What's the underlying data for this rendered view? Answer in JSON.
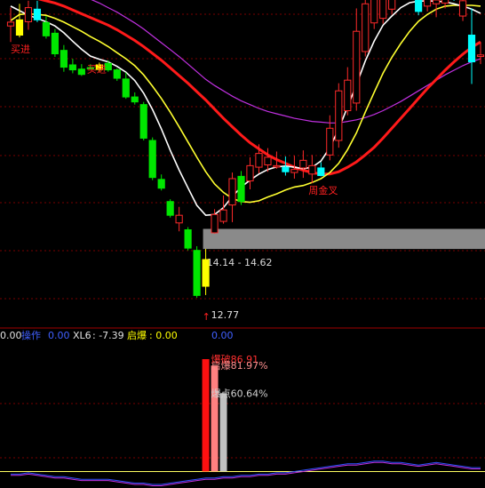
{
  "chart_data": {
    "type": "candlestick",
    "main_panel": {
      "ylim": [
        12.0,
        20.5
      ],
      "candles": [
        {
          "o": 19.82,
          "h": 20.3,
          "l": 19.4,
          "c": 19.92,
          "color": "red"
        },
        {
          "o": 19.98,
          "h": 20.4,
          "l": 19.52,
          "c": 19.58,
          "color": "yellow"
        },
        {
          "o": 19.93,
          "h": 20.48,
          "l": 19.72,
          "c": 20.3,
          "color": "red"
        },
        {
          "o": 20.26,
          "h": 20.48,
          "l": 19.92,
          "c": 19.98,
          "color": "cyan"
        },
        {
          "o": 19.91,
          "h": 20.08,
          "l": 19.49,
          "c": 19.56,
          "color": "green"
        },
        {
          "o": 19.63,
          "h": 19.74,
          "l": 19.01,
          "c": 19.09,
          "color": "green"
        },
        {
          "o": 19.18,
          "h": 19.32,
          "l": 18.62,
          "c": 18.74,
          "color": "green"
        },
        {
          "o": 18.8,
          "h": 18.96,
          "l": 18.58,
          "c": 18.67,
          "color": "green"
        },
        {
          "o": 18.69,
          "h": 18.82,
          "l": 18.51,
          "c": 18.55,
          "color": "green"
        },
        {
          "o": 18.72,
          "h": 18.82,
          "l": 18.69,
          "c": 18.73,
          "color": "green"
        },
        {
          "o": 18.68,
          "h": 18.86,
          "l": 18.62,
          "c": 18.8,
          "color": "yellow"
        },
        {
          "o": 18.84,
          "h": 18.92,
          "l": 18.62,
          "c": 18.67,
          "color": "green"
        },
        {
          "o": 18.67,
          "h": 18.71,
          "l": 18.38,
          "c": 18.45,
          "color": "green"
        },
        {
          "o": 18.43,
          "h": 18.6,
          "l": 17.91,
          "c": 17.96,
          "color": "green"
        },
        {
          "o": 17.96,
          "h": 18.08,
          "l": 17.76,
          "c": 17.83,
          "color": "green"
        },
        {
          "o": 17.76,
          "h": 17.83,
          "l": 16.82,
          "c": 16.88,
          "color": "green"
        },
        {
          "o": 16.82,
          "h": 16.9,
          "l": 15.78,
          "c": 15.85,
          "color": "green"
        },
        {
          "o": 15.8,
          "h": 15.93,
          "l": 15.51,
          "c": 15.57,
          "color": "green"
        },
        {
          "o": 15.22,
          "h": 15.28,
          "l": 14.8,
          "c": 14.86,
          "color": "green"
        },
        {
          "o": 14.66,
          "h": 15.08,
          "l": 14.44,
          "c": 14.86,
          "color": "red"
        },
        {
          "o": 14.48,
          "h": 14.55,
          "l": 13.94,
          "c": 14.0,
          "color": "green"
        },
        {
          "o": 13.94,
          "h": 14.05,
          "l": 12.7,
          "c": 12.76,
          "color": "green"
        },
        {
          "o": 13.0,
          "h": 13.98,
          "l": 12.77,
          "c": 13.7,
          "color": "yellow"
        },
        {
          "o": 14.4,
          "h": 15.02,
          "l": 14.38,
          "c": 14.88,
          "color": "red"
        },
        {
          "o": 14.7,
          "h": 15.38,
          "l": 14.64,
          "c": 15.0,
          "color": "red"
        },
        {
          "o": 15.13,
          "h": 15.98,
          "l": 14.68,
          "c": 15.82,
          "color": "red"
        },
        {
          "o": 15.22,
          "h": 16.02,
          "l": 15.13,
          "c": 15.88,
          "color": "green"
        },
        {
          "o": 15.76,
          "h": 16.38,
          "l": 15.54,
          "c": 16.16,
          "color": "red"
        },
        {
          "o": 16.12,
          "h": 16.72,
          "l": 15.96,
          "c": 16.48,
          "color": "red"
        },
        {
          "o": 16.38,
          "h": 16.62,
          "l": 16.0,
          "c": 16.18,
          "color": "red"
        },
        {
          "o": 16.14,
          "h": 16.53,
          "l": 16.08,
          "c": 16.16,
          "color": "red"
        },
        {
          "o": 16.12,
          "h": 16.4,
          "l": 15.9,
          "c": 16.0,
          "color": "cyan"
        },
        {
          "o": 15.98,
          "h": 16.42,
          "l": 15.82,
          "c": 16.06,
          "color": "red"
        },
        {
          "o": 16.1,
          "h": 16.56,
          "l": 15.84,
          "c": 16.3,
          "color": "red"
        },
        {
          "o": 15.94,
          "h": 16.44,
          "l": 15.7,
          "c": 16.16,
          "color": "red"
        },
        {
          "o": 15.9,
          "h": 16.25,
          "l": 15.88,
          "c": 16.1,
          "color": "cyan"
        },
        {
          "o": 16.44,
          "h": 17.48,
          "l": 16.3,
          "c": 17.14,
          "color": "red"
        },
        {
          "o": 16.82,
          "h": 18.32,
          "l": 16.63,
          "c": 18.12,
          "color": "red"
        },
        {
          "o": 17.6,
          "h": 18.74,
          "l": 17.48,
          "c": 18.4,
          "color": "red"
        },
        {
          "o": 17.8,
          "h": 20.28,
          "l": 17.6,
          "c": 19.68,
          "color": "red"
        },
        {
          "o": 19.15,
          "h": 20.6,
          "l": 19.02,
          "c": 20.4,
          "color": "red"
        },
        {
          "o": 19.9,
          "h": 20.96,
          "l": 19.74,
          "c": 20.64,
          "color": "red"
        },
        {
          "o": 20.02,
          "h": 20.84,
          "l": 19.88,
          "c": 20.56,
          "color": "red"
        },
        {
          "o": 20.26,
          "h": 21.06,
          "l": 20.14,
          "c": 20.86,
          "color": "red"
        },
        {
          "o": 20.62,
          "h": 21.13,
          "l": 20.52,
          "c": 20.76,
          "color": "red"
        },
        {
          "o": 20.88,
          "h": 21.1,
          "l": 20.54,
          "c": 20.72,
          "color": "red"
        },
        {
          "o": 20.96,
          "h": 21.04,
          "l": 20.1,
          "c": 20.2,
          "color": "cyan"
        },
        {
          "o": 20.34,
          "h": 20.94,
          "l": 20.2,
          "c": 20.8,
          "color": "red"
        },
        {
          "o": 20.5,
          "h": 20.78,
          "l": 20.05,
          "c": 20.4,
          "color": "red"
        },
        {
          "o": 20.42,
          "h": 20.82,
          "l": 20.28,
          "c": 20.66,
          "color": "red"
        },
        {
          "o": 20.8,
          "h": 21.12,
          "l": 20.48,
          "c": 20.56,
          "color": "cyan"
        },
        {
          "o": 20.48,
          "h": 20.78,
          "l": 19.95,
          "c": 20.08,
          "color": "red"
        },
        {
          "o": 19.58,
          "h": 20.28,
          "l": 18.3,
          "c": 18.88,
          "color": "cyan"
        },
        {
          "o": 19.06,
          "h": 19.4,
          "l": 18.82,
          "c": 19.02,
          "color": "red"
        }
      ],
      "white_line": [
        20.34,
        20.22,
        20.1,
        20.02,
        19.93,
        19.82,
        19.64,
        19.42,
        19.21,
        19.03,
        18.95,
        18.88,
        18.76,
        18.61,
        18.39,
        18.06,
        17.63,
        17.12,
        16.56,
        16.05,
        15.58,
        15.12,
        14.86,
        14.88,
        15.06,
        15.35,
        15.6,
        15.78,
        15.94,
        16.06,
        16.13,
        16.15,
        16.12,
        16.08,
        16.12,
        16.28,
        16.63,
        17.12,
        17.7,
        18.28,
        18.9,
        19.42,
        19.84,
        20.08,
        20.3,
        20.43,
        20.47,
        20.48,
        20.47,
        20.45,
        20.4,
        20.34,
        20.26,
        20.15
      ],
      "yellow_line": [
        19.96,
        20.12,
        20.14,
        20.12,
        20.1,
        20.02,
        19.92,
        19.8,
        19.68,
        19.54,
        19.42,
        19.28,
        19.12,
        18.96,
        18.78,
        18.54,
        18.24,
        17.92,
        17.56,
        17.18,
        16.78,
        16.38,
        16.0,
        15.68,
        15.46,
        15.3,
        15.22,
        15.2,
        15.24,
        15.34,
        15.42,
        15.52,
        15.6,
        15.64,
        15.72,
        15.82,
        15.98,
        16.22,
        16.58,
        17.02,
        17.56,
        18.08,
        18.58,
        19.0,
        19.36,
        19.68,
        19.94,
        20.12,
        20.26,
        20.34,
        20.36,
        20.36,
        20.36,
        20.34
      ],
      "red_line": [
        20.6,
        20.6,
        20.58,
        20.54,
        20.48,
        20.42,
        20.34,
        20.24,
        20.14,
        20.04,
        19.94,
        19.84,
        19.72,
        19.58,
        19.44,
        19.28,
        19.1,
        18.92,
        18.72,
        18.52,
        18.32,
        18.1,
        17.88,
        17.64,
        17.4,
        17.18,
        16.96,
        16.76,
        16.6,
        16.44,
        16.32,
        16.22,
        16.12,
        16.04,
        15.98,
        15.94,
        15.94,
        16.0,
        16.12,
        16.26,
        16.44,
        16.64,
        16.88,
        17.14,
        17.4,
        17.66,
        17.92,
        18.18,
        18.42,
        18.66,
        18.88,
        19.08,
        19.26,
        19.4
      ],
      "magenta_line": [
        21.2,
        21.16,
        21.1,
        21.02,
        20.96,
        20.88,
        20.8,
        20.72,
        20.62,
        20.52,
        20.42,
        20.3,
        20.18,
        20.04,
        19.9,
        19.74,
        19.56,
        19.38,
        19.2,
        19.02,
        18.82,
        18.62,
        18.42,
        18.26,
        18.12,
        17.98,
        17.86,
        17.76,
        17.66,
        17.58,
        17.52,
        17.46,
        17.4,
        17.36,
        17.32,
        17.3,
        17.28,
        17.28,
        17.32,
        17.36,
        17.42,
        17.5,
        17.6,
        17.72,
        17.84,
        17.98,
        18.12,
        18.26,
        18.4,
        18.54,
        18.66,
        18.78,
        18.88,
        18.96
      ],
      "annotations": [
        {
          "text": "买进",
          "index": 0,
          "price": 19.22,
          "color": "#ff2020"
        },
        {
          "text": "买进",
          "index": 9,
          "price": 18.7,
          "color": "#ff2020"
        },
        {
          "text": "周金叉",
          "index": 34,
          "price": 15.52,
          "color": "#ff2020"
        }
      ],
      "zone": {
        "label": "14.14 - 14.62",
        "low": 14.14,
        "high": 14.62,
        "start_index": 22
      },
      "low_marker": {
        "text": "12.77",
        "price": 12.77,
        "index": 22
      }
    },
    "legend": {
      "items": [
        {
          "name": "",
          "value": "0.00",
          "color": "#e0e0e0"
        },
        {
          "name": "操作",
          "value": "0.00",
          "color": "#4060ff"
        },
        {
          "name": "XL6",
          "value": "-7.39",
          "color": "#e0e0e0"
        },
        {
          "name": "启爆",
          "value": "0.00",
          "color": "#ffff00"
        },
        {
          "name": "",
          "value": "0.00",
          "color": "#4060ff"
        }
      ]
    },
    "indicator": {
      "ylim": [
        -10,
        100
      ],
      "bars": [
        {
          "index": 22,
          "value": 86.91,
          "color": "#ff1010"
        },
        {
          "index": 23,
          "value": 81.97,
          "color": "#ff8080"
        },
        {
          "index": 24,
          "value": 60.64,
          "color": "#c0c0c0"
        }
      ],
      "labels": [
        {
          "text": "爆破86.91",
          "value": 86.91,
          "color": "#ff3030"
        },
        {
          "text": "启爆81.97%",
          "value": 81.97,
          "color": "#ff9090"
        },
        {
          "text": "爆点60.64%",
          "value": 60.64,
          "color": "#d0d0d0"
        }
      ],
      "zero_line": 0,
      "blue_line": [
        -2,
        -2,
        -1,
        -2,
        -3,
        -4,
        -4,
        -5,
        -6,
        -6,
        -6,
        -6,
        -7,
        -8,
        -9,
        -9,
        -10,
        -10,
        -9,
        -8,
        -7,
        -6,
        -5,
        -5,
        -4,
        -4,
        -3,
        -3,
        -2,
        -2,
        -1,
        -1,
        0,
        1,
        2,
        3,
        4,
        5,
        6,
        6,
        7,
        8,
        8,
        7,
        7,
        6,
        5,
        6,
        7,
        6,
        5,
        4,
        3,
        3
      ],
      "magenta_line": [
        -3,
        -3,
        -2,
        -3,
        -4,
        -5,
        -5,
        -6,
        -7,
        -7,
        -7,
        -7,
        -8,
        -9,
        -10,
        -10,
        -11,
        -11,
        -10,
        -9,
        -8,
        -7,
        -6,
        -6,
        -5,
        -5,
        -4,
        -4,
        -3,
        -3,
        -2,
        -2,
        -1,
        0,
        1,
        2,
        3,
        4,
        5,
        5,
        6,
        7,
        7,
        6,
        6,
        5,
        4,
        5,
        6,
        5,
        4,
        3,
        2,
        2
      ]
    }
  }
}
